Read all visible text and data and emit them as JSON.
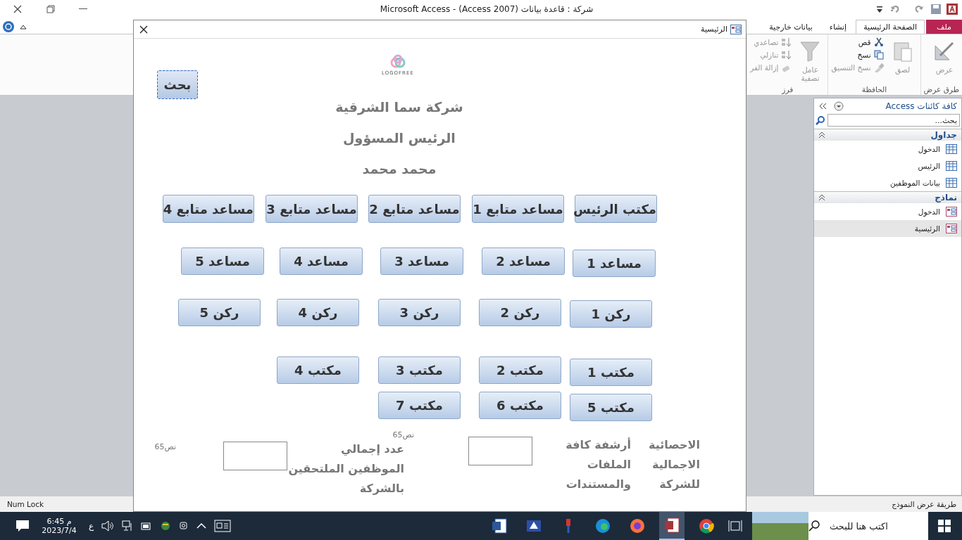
{
  "title_bar": {
    "title": "شركة : قاعدة بيانات (Access 2007) - Microsoft Access"
  },
  "ribbon": {
    "tabs": [
      {
        "label": "ملف",
        "kind": "file",
        "selected": false
      },
      {
        "label": "الصفحة الرئيسية",
        "kind": "tab",
        "selected": true
      },
      {
        "label": "إنشاء",
        "kind": "tab",
        "selected": false
      },
      {
        "label": "بيانات خارجية",
        "kind": "tab",
        "selected": false
      }
    ],
    "groups": [
      {
        "label": "طرق عرض",
        "items": [
          {
            "label": "عرض",
            "kind": "large",
            "disabled": true
          }
        ]
      },
      {
        "label": "الحافظة",
        "items": [
          {
            "label": "لصق",
            "kind": "large",
            "disabled": true
          },
          {
            "label": "قص",
            "kind": "small",
            "disabled": false
          },
          {
            "label": "نسخ",
            "kind": "small",
            "disabled": false
          },
          {
            "label": "نسخ التنسيق",
            "kind": "small",
            "disabled": true
          }
        ]
      },
      {
        "label": "فرز",
        "items": [
          {
            "label": "عامل تصفية",
            "kind": "large",
            "disabled": true
          },
          {
            "label": "تصاعدي",
            "kind": "small",
            "disabled": true
          },
          {
            "label": "تنازلي",
            "kind": "small",
            "disabled": true
          },
          {
            "label": "إزالة الفر",
            "kind": "small",
            "disabled": true
          }
        ]
      }
    ]
  },
  "form": {
    "title": "الرئيسية",
    "search_button": "بحث",
    "logo": "LOGOFREE",
    "headings": [
      "شركة سما الشرقية",
      "الرئيس المسؤول",
      "محمد محمد"
    ],
    "buttons": [
      "مكتب الرئيس",
      "مساعد متابع 1",
      "مساعد متابع 2",
      "مساعد متابع 3",
      "مساعد متابع 4",
      "مساعد 1",
      "مساعد 2",
      "مساعد 3",
      "مساعد 4",
      "مساعد 5",
      "ركن 1",
      "ركن 2",
      "ركن 3",
      "ركن 4",
      "ركن 5",
      "مكتب 1",
      "مكتب 2",
      "مكتب 3",
      "مكتب 4",
      "مكتب 5",
      "مكتب 6",
      "مكتب 7"
    ],
    "bottom": [
      {
        "kind": "label",
        "text": "الاحصائية الاجمالية للشركة"
      },
      {
        "kind": "label",
        "text": "أرشفة كافة الملفات والمستندات"
      },
      {
        "kind": "field"
      },
      {
        "kind": "caption",
        "text": "نص65"
      },
      {
        "kind": "label",
        "text": "عدد إجمالي الموظفين الملتحقين بالشركة"
      },
      {
        "kind": "field"
      },
      {
        "kind": "caption",
        "text": "نص65"
      }
    ]
  },
  "nav_pane": {
    "title": "كافة كائنات Access",
    "search": {
      "placeholder": "بحث..."
    },
    "groups": [
      {
        "label": "جداول",
        "kind": "table",
        "items": [
          {
            "label": "الدخول",
            "selected": false
          },
          {
            "label": "الرئيس",
            "selected": false
          },
          {
            "label": "بيانات الموظفين",
            "selected": false
          }
        ]
      },
      {
        "label": "نماذج",
        "kind": "form",
        "items": [
          {
            "label": "الدخول",
            "selected": false
          },
          {
            "label": "الرئيسية",
            "selected": true
          }
        ]
      }
    ]
  },
  "status_bar": {
    "left": "Num Lock",
    "right": "طريقة عرض النموذج"
  },
  "taskbar": {
    "search_placeholder": "اكتب هنا للبحث",
    "apps": [
      {
        "kind": "word",
        "selected": false
      },
      {
        "kind": "scanner",
        "selected": false
      },
      {
        "kind": "pin",
        "selected": false
      },
      {
        "kind": "edge",
        "selected": false
      },
      {
        "kind": "firefox",
        "selected": false
      },
      {
        "kind": "access",
        "selected": true
      },
      {
        "kind": "chrome",
        "selected": false
      }
    ],
    "language": "ع",
    "time": "6:45 م",
    "date": "2023/7/4"
  }
}
